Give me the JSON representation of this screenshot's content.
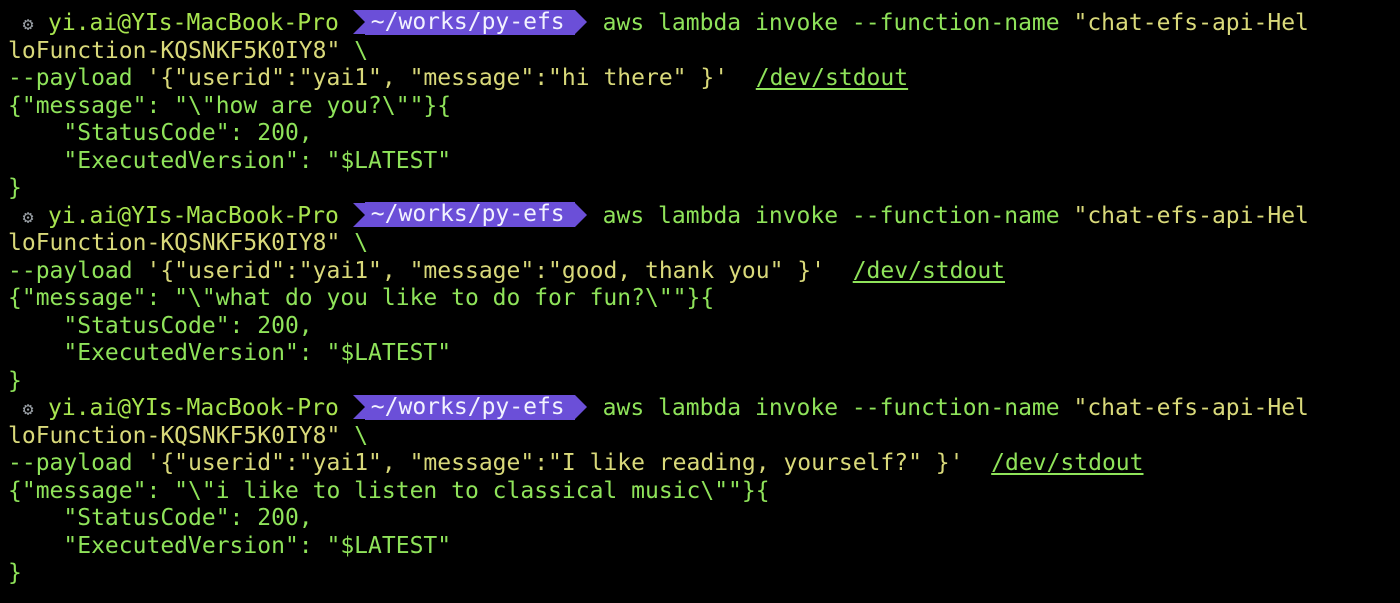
{
  "colors": {
    "background": "#000000",
    "text_green": "#8fe35a",
    "string_yellow": "#d9d97a",
    "prompt_purple": "#6b4fd8"
  },
  "prompt": {
    "icon": "gear-icon",
    "user_host": "yi.ai@YIs-MacBook-Pro",
    "cwd": "~/works/py-efs"
  },
  "blocks": [
    {
      "cmd_start": "aws lambda invoke --function-name ",
      "func_part1": "\"chat-efs-api-Hel",
      "func_part2": "loFunction-KQSNKF5K0IY8\"",
      "cont": " \\",
      "payload_flag": "--payload ",
      "payload": "'{\"userid\":\"yai1\", \"message\":\"hi there\" }'",
      "outfile": "/dev/stdout",
      "response": "{\"message\": \"\\\"how are you?\\\"\"}{",
      "status_line": "    \"StatusCode\": 200,",
      "version_line": "    \"ExecutedVersion\": \"$LATEST\"",
      "close": "}"
    },
    {
      "cmd_start": "aws lambda invoke --function-name ",
      "func_part1": "\"chat-efs-api-Hel",
      "func_part2": "loFunction-KQSNKF5K0IY8\"",
      "cont": " \\",
      "payload_flag": "--payload ",
      "payload": "'{\"userid\":\"yai1\", \"message\":\"good, thank you\" }'",
      "outfile": "/dev/stdout",
      "response": "{\"message\": \"\\\"what do you like to do for fun?\\\"\"}{",
      "status_line": "    \"StatusCode\": 200,",
      "version_line": "    \"ExecutedVersion\": \"$LATEST\"",
      "close": "}"
    },
    {
      "cmd_start": "aws lambda invoke --function-name ",
      "func_part1": "\"chat-efs-api-Hel",
      "func_part2": "loFunction-KQSNKF5K0IY8\"",
      "cont": " \\",
      "payload_flag": "--payload ",
      "payload": "'{\"userid\":\"yai1\", \"message\":\"I like reading, yourself?\" }'",
      "outfile": "/dev/stdout",
      "response": "{\"message\": \"\\\"i like to listen to classical music\\\"\"}{",
      "status_line": "    \"StatusCode\": 200,",
      "version_line": "    \"ExecutedVersion\": \"$LATEST\"",
      "close": "}"
    }
  ]
}
